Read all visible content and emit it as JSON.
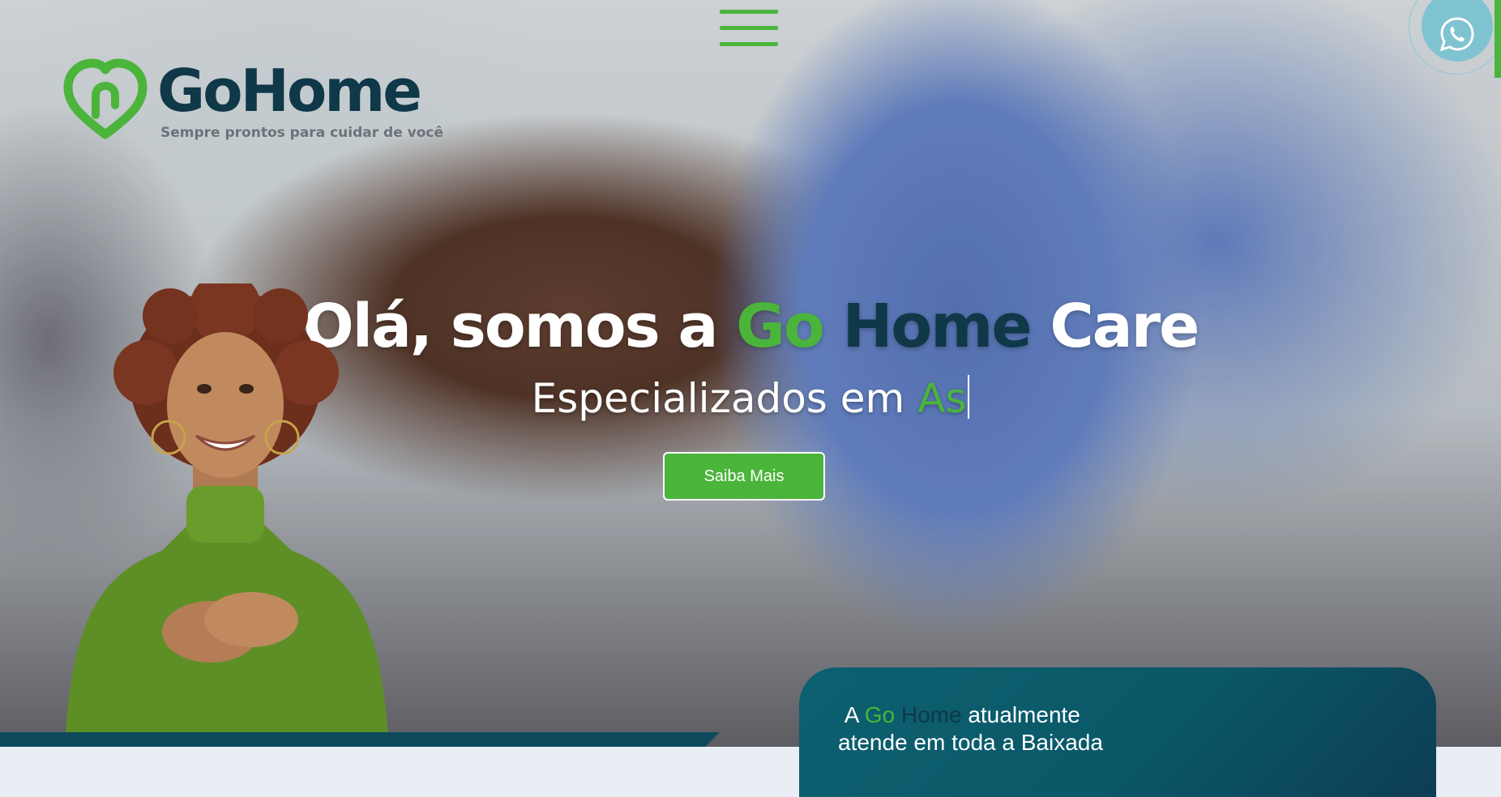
{
  "brand": {
    "name": "GoHome",
    "tagline": "Sempre prontos para cuidar de você"
  },
  "nav": {
    "menu_icon": "hamburger-menu-icon"
  },
  "whatsapp": {
    "icon": "whatsapp-icon"
  },
  "hero": {
    "headline_prefix": "Olá, somos a",
    "headline_go": "Go",
    "headline_home": "Home",
    "headline_suffix": "Care",
    "subheadline_static": "Especializados em",
    "subheadline_typed": "As",
    "cta_label": "Saiba Mais"
  },
  "info": {
    "prefix": "A",
    "go": "Go",
    "home": "Home",
    "line1_suffix": "atualmente",
    "line2": "atende em toda a Baixada"
  },
  "colors": {
    "brand_green": "#4bb43b",
    "brand_navy": "#0f3848",
    "card_teal": "#0d6070",
    "whatsapp_bg": "#7fc3d0"
  }
}
